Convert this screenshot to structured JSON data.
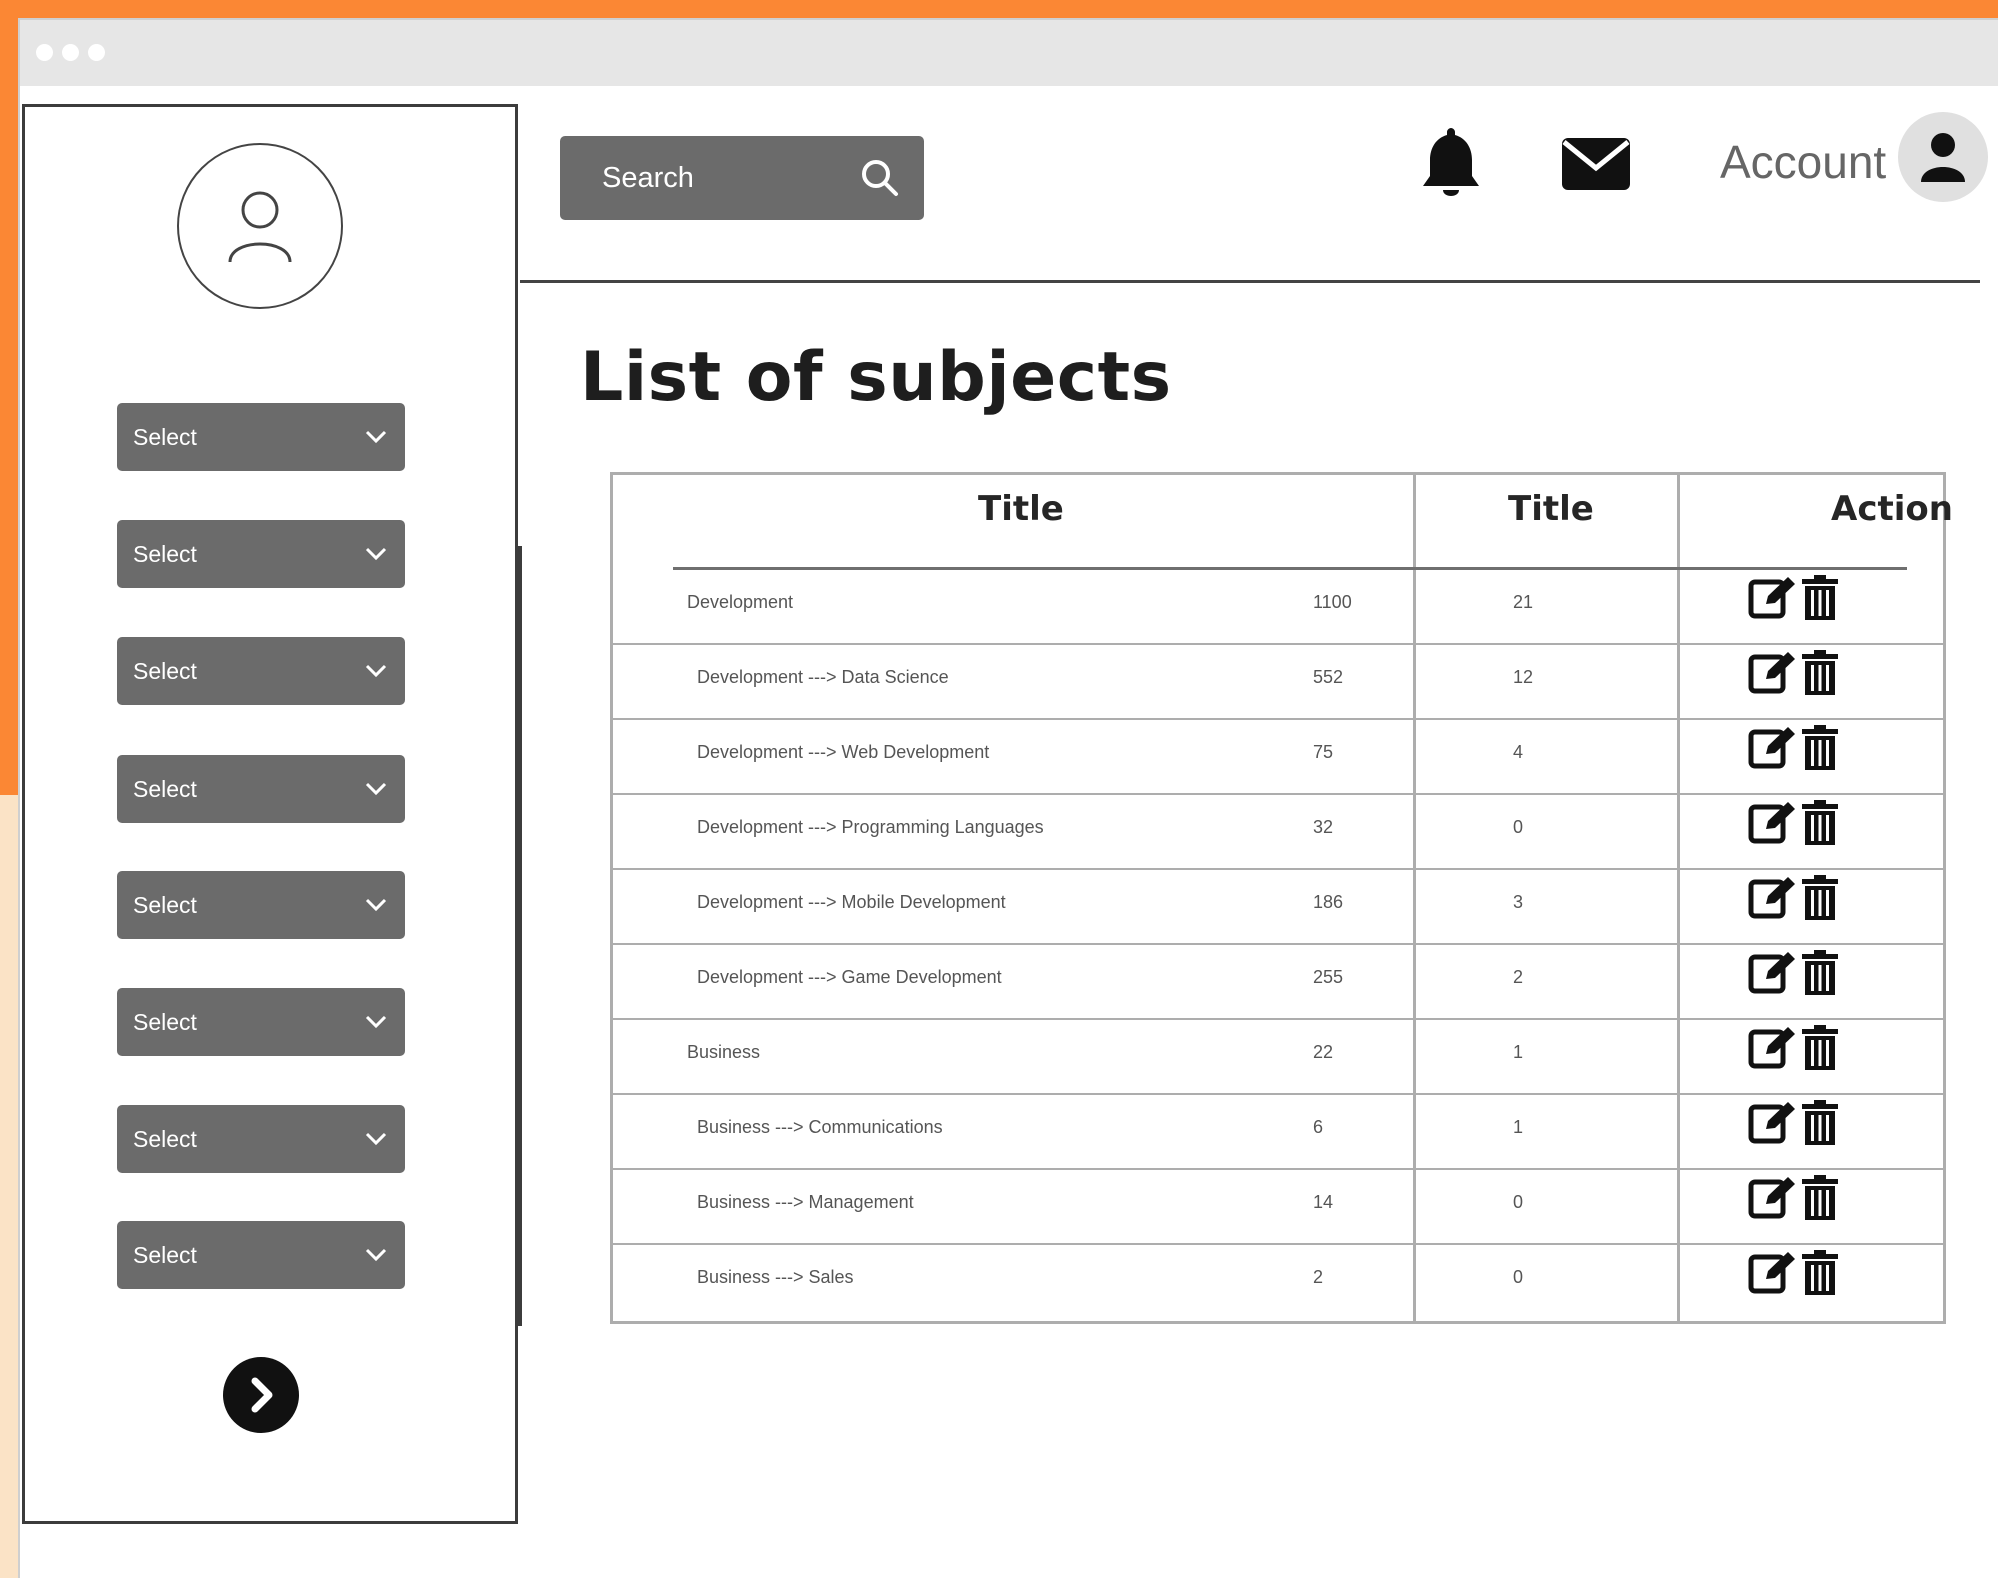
{
  "header": {
    "search_label": "Search",
    "account_label": "Account"
  },
  "sidebar": {
    "selects": [
      "Select",
      "Select",
      "Select",
      "Select",
      "Select",
      "Select",
      "Select",
      "Select"
    ]
  },
  "main": {
    "page_title": "List of subjects",
    "table": {
      "headers": [
        "Title",
        "Title",
        "Action"
      ],
      "rows": [
        {
          "title": "Development",
          "count": "1100",
          "sub": "21"
        },
        {
          "title": "Development ---> Data Science",
          "count": "552",
          "sub": "12"
        },
        {
          "title": "Development ---> Web Development",
          "count": "75",
          "sub": "4"
        },
        {
          "title": "Development ---> Programming Languages",
          "count": "32",
          "sub": "0"
        },
        {
          "title": "Development ---> Mobile Development",
          "count": "186",
          "sub": "3"
        },
        {
          "title": "Development ---> Game Development",
          "count": "255",
          "sub": "2"
        },
        {
          "title": "Business",
          "count": "22",
          "sub": "1"
        },
        {
          "title": "Business ---> Communications",
          "count": "6",
          "sub": "1"
        },
        {
          "title": "Business ---> Management",
          "count": "14",
          "sub": "0"
        },
        {
          "title": "Business ---> Sales",
          "count": "2",
          "sub": "0"
        }
      ]
    }
  },
  "colors": {
    "accent_orange": "#fb8734",
    "panel_gray": "#6b6b6b",
    "background_cream": "#fbe3c6"
  },
  "icons": [
    "user-outline-icon",
    "chevron-down-icon",
    "chevron-right-icon",
    "search-icon",
    "bell-icon",
    "mail-icon",
    "user-icon",
    "edit-icon",
    "trash-icon"
  ]
}
